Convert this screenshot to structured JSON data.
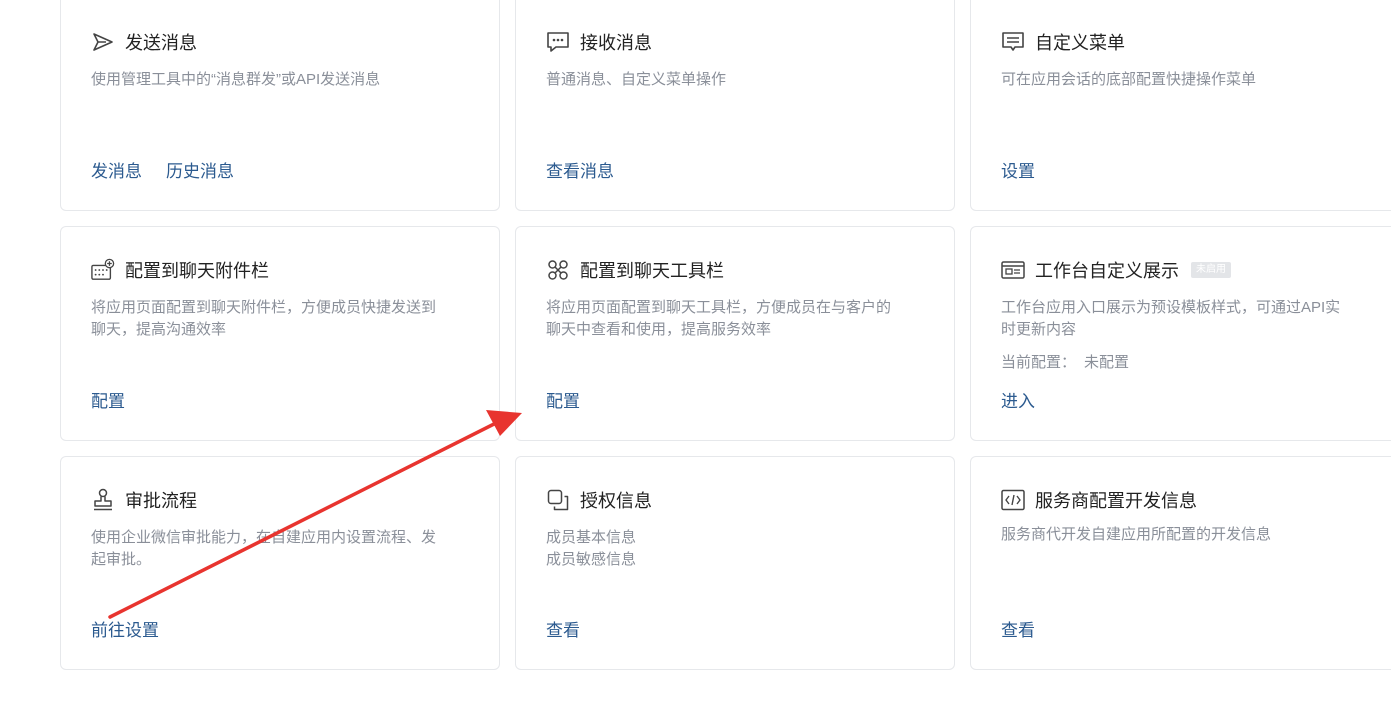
{
  "cards": [
    {
      "id": "send",
      "icon": "send-icon",
      "title": "发送消息",
      "desc": [
        "使用管理工具中的“消息群发”或API发送消息"
      ],
      "actions": [
        "发消息",
        "历史消息"
      ]
    },
    {
      "id": "receive",
      "icon": "chat-bubble-icon",
      "title": "接收消息",
      "desc": [
        "普通消息、自定义菜单操作"
      ],
      "actions": [
        "查看消息"
      ]
    },
    {
      "id": "custom-menu",
      "icon": "menu-icon",
      "title": "自定义菜单",
      "desc": [
        "可在应用会话的底部配置快捷操作菜单"
      ],
      "actions": [
        "设置"
      ]
    },
    {
      "id": "chat-attachment",
      "icon": "keyboard-plus-icon",
      "title": "配置到聊天附件栏",
      "desc": [
        "将应用页面配置到聊天附件栏，方便成员快捷发送到",
        "聊天，提高沟通效率"
      ],
      "actions": [
        "配置"
      ]
    },
    {
      "id": "chat-toolbar",
      "icon": "toolbar-icon",
      "title": "配置到聊天工具栏",
      "desc": [
        "将应用页面配置到聊天工具栏，方便成员在与客户的",
        "聊天中查看和使用，提高服务效率"
      ],
      "actions": [
        "配置"
      ]
    },
    {
      "id": "workbench",
      "icon": "id-card-icon",
      "title": "工作台自定义展示",
      "badge": "未启用",
      "desc": [
        "工作台应用入口展示为预设模板样式，可通过API实",
        "时更新内容"
      ],
      "config_label": "当前配置：",
      "config_value": "未配置",
      "actions": [
        "进入"
      ]
    },
    {
      "id": "approval",
      "icon": "stamp-icon",
      "title": "审批流程",
      "desc": [
        "使用企业微信审批能力，在自建应用内设置流程、发",
        "起审批。"
      ],
      "actions": [
        "前往设置"
      ]
    },
    {
      "id": "auth-info",
      "icon": "copy-icon",
      "title": "授权信息",
      "desc": [
        "成员基本信息",
        "成员敏感信息"
      ],
      "actions": [
        "查看"
      ]
    },
    {
      "id": "dev-info",
      "icon": "code-icon",
      "title": "服务商配置开发信息",
      "desc": [
        "服务商代开发自建应用所配置的开发信息"
      ],
      "actions": [
        "查看"
      ]
    }
  ],
  "annotation": {
    "arrow_color": "#e8342f"
  }
}
